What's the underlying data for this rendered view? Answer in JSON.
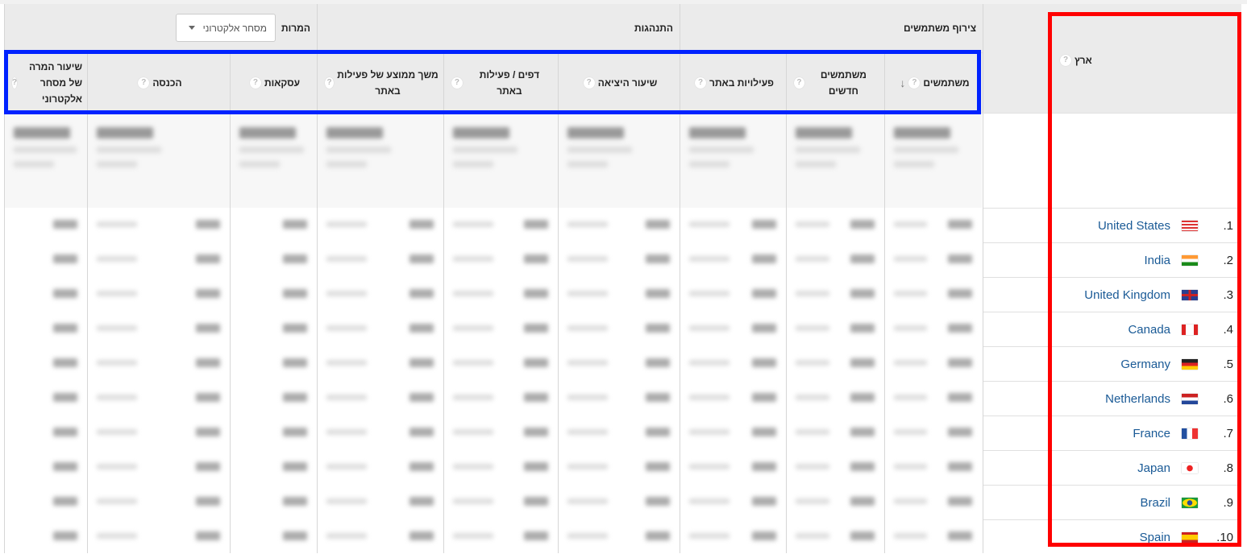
{
  "header": {
    "groups": {
      "acquisition": "צירוף משתמשים",
      "behavior": "התנהגות",
      "conversions": "המרות"
    },
    "conversions_dropdown": {
      "selected": "מסחר אלקטרוני",
      "icon": "caret-down-icon"
    },
    "dimension": {
      "label": "ארץ",
      "icon": "help-icon"
    },
    "columns": [
      {
        "label": "משתמשים",
        "sorted": "descending"
      },
      {
        "label": "משתמשים חדשים"
      },
      {
        "label": "פעילויות באתר"
      },
      {
        "label": "שיעור היציאה"
      },
      {
        "label": "דפים / פעילות באתר"
      },
      {
        "label": "משך ממוצע של פעילות באתר"
      },
      {
        "label": "עסקאות"
      },
      {
        "label": "הכנסה"
      },
      {
        "label": "שיעור המרה של מסחר אלקטרוני"
      }
    ]
  },
  "rows": [
    {
      "rank": "1.",
      "country": "United States",
      "flag": "us"
    },
    {
      "rank": "2.",
      "country": "India",
      "flag": "in"
    },
    {
      "rank": "3.",
      "country": "United Kingdom",
      "flag": "gb"
    },
    {
      "rank": "4.",
      "country": "Canada",
      "flag": "ca"
    },
    {
      "rank": "5.",
      "country": "Germany",
      "flag": "de"
    },
    {
      "rank": "6.",
      "country": "Netherlands",
      "flag": "nl"
    },
    {
      "rank": "7.",
      "country": "France",
      "flag": "fr"
    },
    {
      "rank": "8.",
      "country": "Japan",
      "flag": "jp"
    },
    {
      "rank": "9.",
      "country": "Brazil",
      "flag": "br"
    },
    {
      "rank": "10.",
      "country": "Spain",
      "flag": "es"
    }
  ],
  "colors": {
    "highlight_dimension": "#ff0000",
    "highlight_metrics": "#0022ff",
    "link": "#1a5a96",
    "header_bg": "#ebebeb"
  }
}
